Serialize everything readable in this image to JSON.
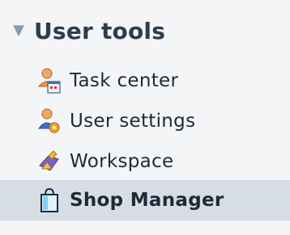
{
  "section": {
    "title": "User tools",
    "toggle_icon": "collapse-triangle-icon"
  },
  "items": [
    {
      "label": "Task center",
      "icon": "task-center-icon"
    },
    {
      "label": "User settings",
      "icon": "user-settings-icon"
    },
    {
      "label": "Workspace",
      "icon": "workspace-icon"
    },
    {
      "label": "Shop Manager",
      "icon": "shop-manager-icon",
      "selected": true
    }
  ],
  "colors": {
    "background": "#f4f5f7",
    "selected_row": "#d6dde5",
    "header_text": "#2d3d4f",
    "item_text": "#1d2a36"
  }
}
